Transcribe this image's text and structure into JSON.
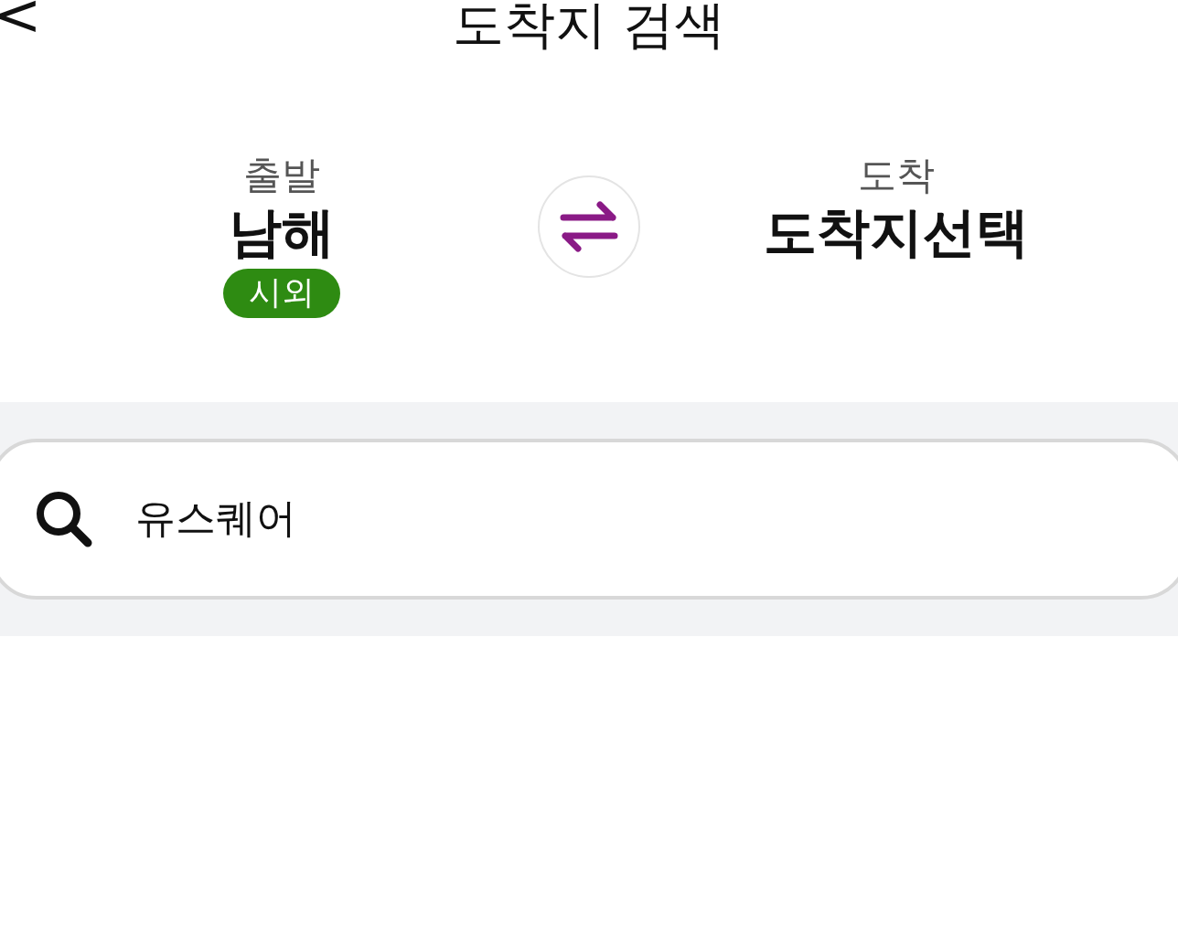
{
  "header": {
    "back": "<",
    "title": "도착지 검색"
  },
  "departure": {
    "label": "출발",
    "name": "남해",
    "tag": {
      "label": "시외",
      "color": "#2e8b12"
    }
  },
  "arrival": {
    "label": "도착",
    "name": "도착지선택"
  },
  "search": {
    "value": "유스퀘어"
  }
}
